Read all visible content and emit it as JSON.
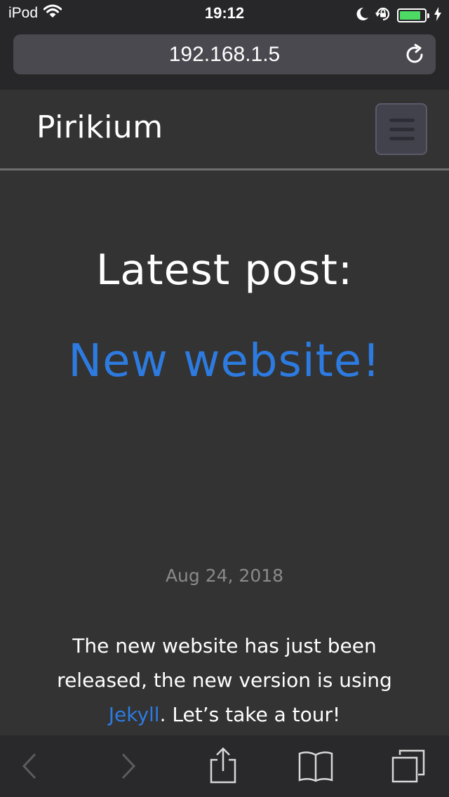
{
  "status_bar": {
    "device": "iPod",
    "time": "19:12",
    "battery_level": 0.85
  },
  "browser": {
    "address": "192.168.1.5"
  },
  "site": {
    "title": "Pirikium"
  },
  "main": {
    "heading": "Latest post:",
    "post_title": "New website!",
    "post_date": "Aug 24, 2018",
    "excerpt_before": "The new website has just been released, the new version is using ",
    "excerpt_link": "Jekyll",
    "excerpt_after": ". Let’s take a tour!"
  },
  "colors": {
    "page_bg": "#333333",
    "link": "#2d7be0",
    "battery": "#4cd964"
  }
}
